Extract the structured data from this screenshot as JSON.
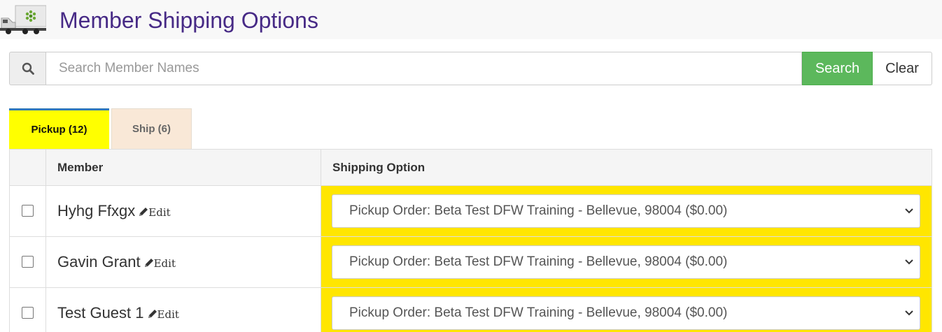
{
  "header": {
    "title": "Member Shipping Options",
    "logo_icon": "truck-icon"
  },
  "search": {
    "placeholder": "Search Member Names",
    "search_label": "Search",
    "clear_label": "Clear",
    "icon": "search-icon"
  },
  "tabs": [
    {
      "label": "Pickup (12)",
      "active": true
    },
    {
      "label": "Ship (6)",
      "active": false
    }
  ],
  "table": {
    "headers": {
      "member": "Member",
      "shipping": "Shipping Option"
    },
    "edit_label": "Edit",
    "rows": [
      {
        "member": "Hyhg Ffxgx",
        "shipping_option": "Pickup Order: Beta Test DFW Training - Bellevue, 98004 ($0.00)"
      },
      {
        "member": "Gavin Grant",
        "shipping_option": "Pickup Order: Beta Test DFW Training - Bellevue, 98004 ($0.00)"
      },
      {
        "member": "Test Guest 1",
        "shipping_option": "Pickup Order: Beta Test DFW Training - Bellevue, 98004 ($0.00)"
      }
    ]
  },
  "colors": {
    "title": "#472a86",
    "search_button": "#5cb85c",
    "active_tab": "#ffff00",
    "inactive_tab": "#f9e8d7",
    "shipping_cell": "#ffe600"
  }
}
